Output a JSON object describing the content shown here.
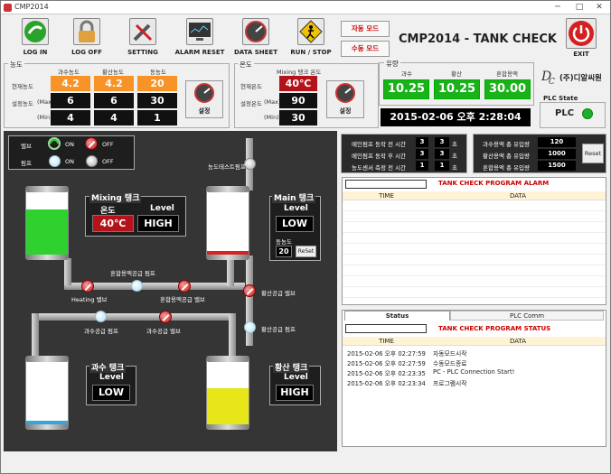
{
  "window": {
    "title": "CMP2014",
    "min": "─",
    "max": "□",
    "close": "✕"
  },
  "toolbar": [
    {
      "label": "LOG IN",
      "icon": "login-icon"
    },
    {
      "label": "LOG OFF",
      "icon": "lock-icon"
    },
    {
      "label": "SETTING",
      "icon": "tools-icon"
    },
    {
      "label": "ALARM RESET",
      "icon": "monitor-icon"
    },
    {
      "label": "DATA SHEET",
      "icon": "gauge-icon"
    },
    {
      "label": "RUN / STOP",
      "icon": "run-sign-icon"
    },
    {
      "label": "EXIT",
      "icon": "power-icon"
    }
  ],
  "modes": {
    "auto": "자동 모드",
    "manual": "수동 모드"
  },
  "app_title": "CMP2014 - TANK CHECK",
  "concentration": {
    "group": "농도",
    "cols": [
      "과수농도",
      "황산농도",
      "동농도"
    ],
    "current_label": "현재농도",
    "max_label": "설정농도",
    "max_unit": "(Max)",
    "min_unit": "(Min)",
    "current": [
      "4.2",
      "4.2",
      "20"
    ],
    "max": [
      "6",
      "6",
      "30"
    ],
    "min": [
      "4",
      "4",
      "1"
    ],
    "set_button": "설정"
  },
  "temperature": {
    "group": "온도",
    "col": "Mixing 탱크 온도",
    "current_label": "현재온도",
    "max_label": "설정온도",
    "max_unit": "(Max)",
    "min_unit": "(Min)",
    "current": "40℃",
    "max": "90",
    "min": "30",
    "set_button": "설정"
  },
  "flow": {
    "group": "유량",
    "cols": [
      "과수",
      "황산",
      "혼합용액"
    ],
    "values": [
      "10.25",
      "10.25",
      "30.00"
    ]
  },
  "datetime": "2015-02-06 오후 2:28:04",
  "logo": {
    "text": "(주)디알씨원"
  },
  "plc": {
    "title": "PLC State",
    "label": "PLC",
    "color": "#1fae2d"
  },
  "legend": {
    "valve_label": "밸브",
    "pump_label": "펌프",
    "on": "ON",
    "off": "OFF"
  },
  "timers": [
    {
      "label": "메인펌프 동작 전 시간",
      "value": "3",
      "unit": "초"
    },
    {
      "label": "메인펌프 동작 후 시간",
      "value": "3",
      "unit": "초"
    },
    {
      "label": "농도센서 측정 전 시간",
      "value": "1",
      "unit": "초"
    }
  ],
  "totals": [
    {
      "label": "과수용액 총 유입량",
      "value": "120"
    },
    {
      "label": "황산용액 총 유입량",
      "value": "1000"
    },
    {
      "label": "혼합용액 총 유입량",
      "value": "1500"
    }
  ],
  "totals_reset": "Reset",
  "process": {
    "conc_test_pump": "농도테스트펌프",
    "mixing_tank": "Mixing 탱크",
    "temp_label": "온도",
    "level_label": "Level",
    "mixing_temp": "40℃",
    "mixing_level": "HIGH",
    "main_tank": "Main 탱크",
    "main_level": "LOW",
    "cu_conc_label": "동농도",
    "cu_conc": "20",
    "reset": "ReSet",
    "mix_supply_pump": "혼합용액공급 펌프",
    "heating_valve": "Heating 밸브",
    "mix_supply_valve": "혼합용액공급 밸브",
    "acid_supply_valve": "황산공급 밸브",
    "acid_supply_pump": "황산공급 펌프",
    "h2o2_supply_valve": "과수공급 밸브",
    "h2o2_supply_pump": "과수공급 펌프",
    "h2o2_tank": "과수 탱크",
    "h2o2_level": "LOW",
    "acid_tank": "황산 탱크",
    "acid_level": "HIGH"
  },
  "alarm": {
    "title": "TANK CHECK PROGRAM ALARM",
    "col_time": "TIME",
    "col_data": "DATA"
  },
  "status_panel": {
    "tabs": [
      "Status",
      "PLC Comm"
    ],
    "title": "TANK CHECK PROGRAM STATUS",
    "col_time": "TIME",
    "col_data": "DATA",
    "rows": [
      {
        "time": "2015-02-06 오후 02:27:59",
        "data": "자동모드시작"
      },
      {
        "time": "2015-02-06 오후 02:27:59",
        "data": "수동모드종료"
      },
      {
        "time": "2015-02-06 오후 02:23:35",
        "data": "PC - PLC Connection Start!"
      },
      {
        "time": "2015-02-06 오후 02:23:34",
        "data": "프로그램시작"
      }
    ]
  },
  "colors": {
    "accent_orange": "#f79327",
    "alarm_red": "#b4131a",
    "flow_green": "#19b219",
    "mixing_fill": "#2fd12f",
    "h2o2_fill": "#3aa3d8",
    "acid_fill": "#e6e618",
    "main_fill": "#d42424"
  },
  "levels": {
    "mixing": 0.7,
    "main": 0.05,
    "h2o2": 0.05,
    "acid": 0.55
  }
}
